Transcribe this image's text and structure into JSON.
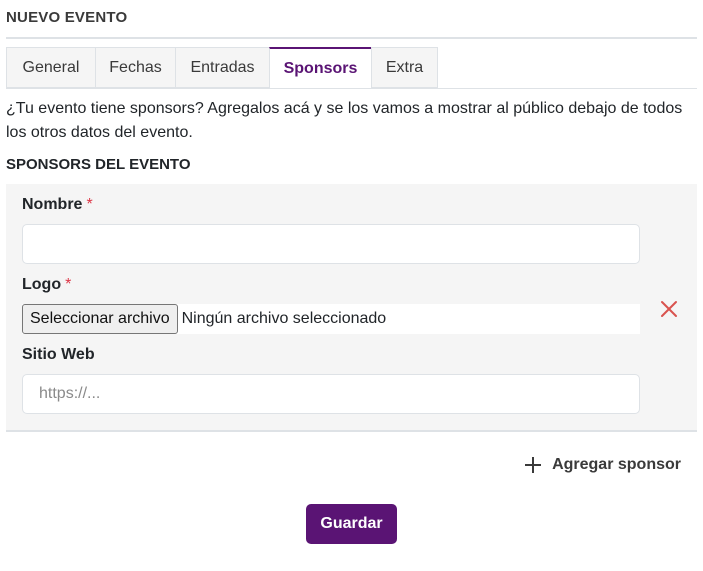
{
  "page_title": "NUEVO EVENTO",
  "tabs": [
    {
      "label": "General",
      "active": false
    },
    {
      "label": "Fechas",
      "active": false
    },
    {
      "label": "Entradas",
      "active": false
    },
    {
      "label": "Sponsors",
      "active": true
    },
    {
      "label": "Extra",
      "active": false
    }
  ],
  "intro_text": "¿Tu evento tiene sponsors? Agregalos acá y se los vamos a mostrar al público debajo de todos los otros datos del evento.",
  "section_heading": "SPONSORS DEL EVENTO",
  "sponsor_form": {
    "nombre_label": "Nombre",
    "nombre_value": "",
    "logo_label": "Logo",
    "required_marker": "*",
    "file_button_label": "Seleccionar archivo",
    "file_status": "Ningún archivo seleccionado",
    "sitio_web_label": "Sitio Web",
    "sitio_web_placeholder": "https://...",
    "sitio_web_value": "",
    "remove_icon": "close-x-icon"
  },
  "add_sponsor_label": "Agregar sponsor",
  "add_icon": "plus-icon",
  "save_label": "Guardar",
  "colors": {
    "accent": "#5a1474",
    "required": "#dc3545",
    "remove": "#d9534f",
    "card_bg": "#f5f5f5",
    "border": "#dee2e6"
  }
}
